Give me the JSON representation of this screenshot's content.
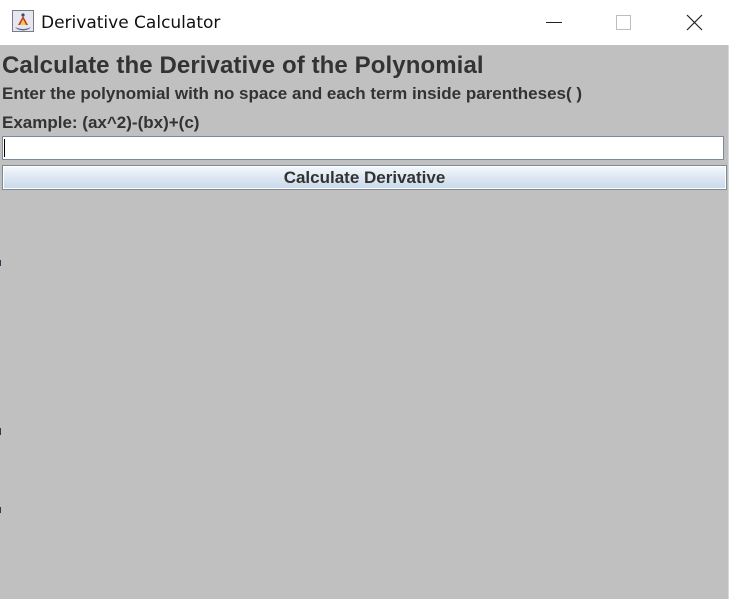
{
  "window": {
    "title": "Derivative Calculator",
    "controls": {
      "minimize": "minimize-icon",
      "maximize": "maximize-icon",
      "close": "close-icon"
    }
  },
  "main": {
    "heading": "Calculate the Derivative of the Polynomial",
    "instruction": "Enter the polynomial with no space and each term inside parentheses( )",
    "example": "Example: (ax^2)-(bx)+(c)",
    "input": {
      "value": "",
      "placeholder": ""
    },
    "button_label": "Calculate Derivative"
  },
  "colors": {
    "panel_background": "#c0c0c0",
    "text": "#333333",
    "button_top": "#f4f8fc",
    "button_bottom": "#c9d8e8"
  }
}
